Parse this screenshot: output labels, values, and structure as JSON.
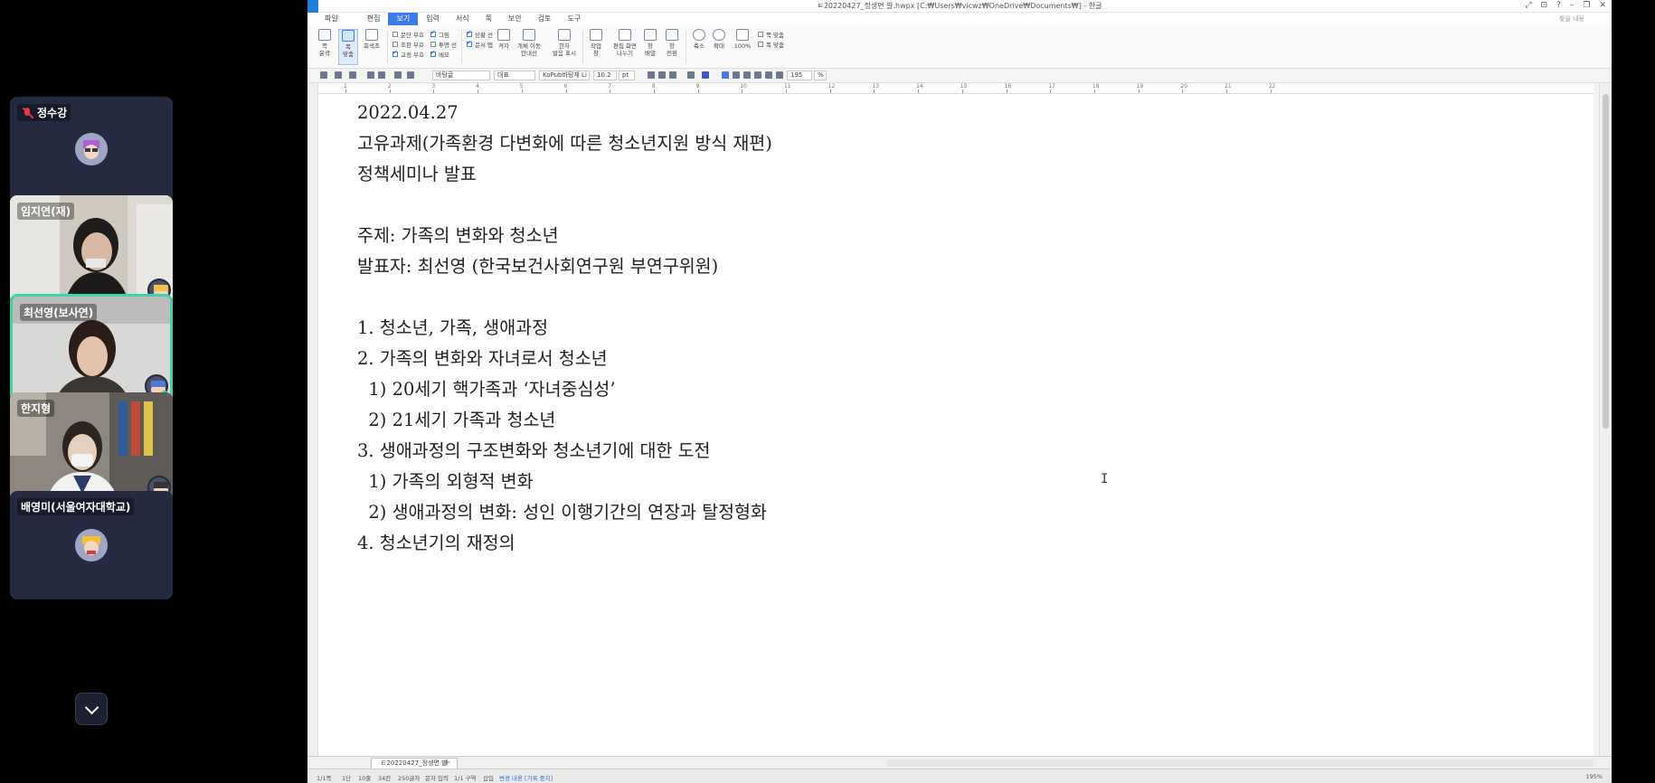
{
  "participants": [
    {
      "name": "정수강",
      "muted": true,
      "camera": false
    },
    {
      "name": "임지연(재)",
      "muted": false,
      "camera": true
    },
    {
      "name": "최선영(보사연)",
      "muted": false,
      "camera": true,
      "speaking": true
    },
    {
      "name": "한지형",
      "muted": false,
      "camera": true
    },
    {
      "name": "배영미(서울여자대학교)",
      "muted": false,
      "camera": false
    }
  ],
  "app": {
    "window_title": "ㅌ20220427_정생면 발.hwpx [C:₩Users₩vicwz₩OneDrive₩Documents₩] - 한글",
    "window_buttons": [
      "⤢",
      "⊡",
      "?",
      "–",
      "❐",
      "✕"
    ],
    "menus": [
      "파일",
      "편집",
      "보기",
      "입력",
      "서식",
      "쪽",
      "보안",
      "검토",
      "도구"
    ],
    "active_menu": "보기",
    "help_text": "찾을 내용",
    "ribbon": {
      "buttons": [
        {
          "label": "쪽\n윤곽"
        },
        {
          "label": "폭\n맞춤"
        },
        {
          "label": "회색조"
        },
        {
          "label": "격자"
        },
        {
          "label": "개체 이동\n안내선"
        },
        {
          "label": "한자\n발음 표시"
        },
        {
          "label": "작업\n창"
        },
        {
          "label": "편집 화면\n나누기"
        },
        {
          "label": "창\n배열"
        },
        {
          "label": "창\n전환"
        },
        {
          "label": "축소"
        },
        {
          "label": "확대"
        },
        {
          "label": "100%"
        }
      ],
      "checks_col1": [
        {
          "label": "문단 부호",
          "on": false
        },
        {
          "label": "조판 부호",
          "on": false
        },
        {
          "label": "교정 부호",
          "on": true
        }
      ],
      "checks_col2": [
        {
          "label": "그림",
          "on": true
        },
        {
          "label": "투명 선",
          "on": false
        },
        {
          "label": "메모",
          "on": true
        }
      ],
      "checks_col3": [
        {
          "label": "상황 선",
          "on": true
        },
        {
          "label": "문서 탭",
          "on": true
        }
      ],
      "fit_options": [
        "쪽 맞춤",
        "폭 맞춤"
      ]
    },
    "formatting": {
      "style": "바탕글",
      "language": "대표",
      "font": "KoPub바탕체 Li",
      "size": "10.2",
      "size_unit": "pt",
      "zoom": "195",
      "zoom_unit": "%"
    },
    "ruler_numbers": [
      "1",
      "2",
      "3",
      "4",
      "5",
      "6",
      "7",
      "8",
      "9",
      "10",
      "11",
      "12",
      "13",
      "14",
      "15",
      "16",
      "17",
      "18",
      "19",
      "20",
      "21",
      "22"
    ],
    "document_lines": [
      "2022.04.27",
      "고유과제(가족환경 다변화에 따른 청소년지원 방식 재편)",
      "정책세미나 발표",
      "",
      "주제: 가족의 변화와 청소년",
      "발표자: 최선영 (한국보건사회연구원 부연구위원)",
      "",
      "1. 청소년, 가족, 생애과정",
      "2. 가족의 변화와 자녀로서 청소년",
      "  1) 20세기 핵가족과 ‘자녀중심성’",
      "  2) 21세기 가족과 청소년",
      "3. 생애과정의 구조변화와 청소년기에 대한 도전",
      "  1) 가족의 외형적 변화",
      "  2) 생애과정의 변화: 성인 이행기간의 연장과 탈정형화",
      "4. 청소년기의 재정의"
    ],
    "tab_name": "ㅌ20220427_정생면 발",
    "tab_add": "+",
    "status": {
      "page": "1/1쪽",
      "section": "1단",
      "line": "10줄",
      "col": "34칸",
      "chars": "250글자",
      "mode": "문자 입력",
      "sect": "1/1 구역",
      "insert": "삽입",
      "track": "변경 내용 [기록 중지]",
      "zoom": "195%"
    }
  },
  "colors": {
    "active_border": "#3fd3a9",
    "tile_bg": "#262a40",
    "muted_red": "#e53946",
    "menu_active": "#3c7be8"
  },
  "icons": {
    "show_more": "chevron-down-icon",
    "text_cursor": "i-beam-cursor-icon"
  }
}
